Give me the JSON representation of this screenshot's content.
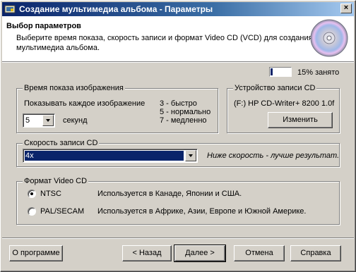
{
  "window": {
    "title": "Создание мультимедиа альбома - Параметры",
    "close_glyph": "×"
  },
  "header": {
    "title": "Выбор параметров",
    "description": "Выберите время показа, скорость записи и формат Video CD (VCD) для создания мультимедиа альбома.",
    "icon": "cd-disc-icon"
  },
  "usage": {
    "percent": 15,
    "label": "15% занято"
  },
  "display_time": {
    "legend": "Время показа изображения",
    "prompt": "Показывать каждое изображение",
    "value": "5",
    "unit": "секунд",
    "hints": [
      "3 - быстро",
      "5 - нормально",
      "7 - медленно"
    ]
  },
  "recorder": {
    "legend": "Устройство записи CD",
    "device": "(F:) HP CD-Writer+ 8200 1.0f",
    "change_button": "Изменить"
  },
  "speed": {
    "legend": "Скорость записи CD",
    "value": "4x",
    "hint": "Ниже скорость - лучше результат."
  },
  "video_format": {
    "legend": "Формат Video CD",
    "options": [
      {
        "label": "NTSC",
        "description": "Используется в Канаде, Японии и США.",
        "checked": true
      },
      {
        "label": "PAL/SECAM",
        "description": "Используется в Африке, Азии, Европе и Южной Америке.",
        "checked": false
      }
    ]
  },
  "footer": {
    "about": "О программе",
    "back": "< Назад",
    "next": "Далее >",
    "cancel": "Отмена",
    "help": "Справка"
  },
  "colors": {
    "title_start": "#0a246a",
    "title_end": "#a6caf0",
    "face": "#d4d0c8",
    "selection": "#0a246a"
  }
}
